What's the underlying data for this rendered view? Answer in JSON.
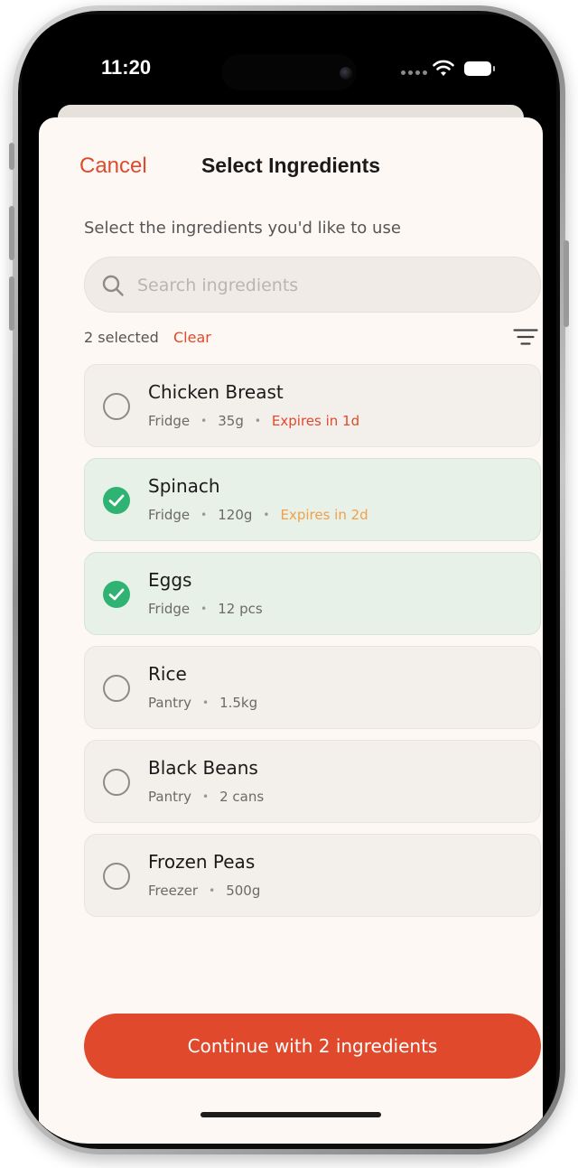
{
  "status": {
    "time": "11:20"
  },
  "header": {
    "cancel_label": "Cancel",
    "title": "Select Ingredients"
  },
  "subtitle": "Select the ingredients you'd like to use",
  "search": {
    "placeholder": "Search ingredients",
    "value": ""
  },
  "selection": {
    "count_label": "2 selected",
    "clear_label": "Clear"
  },
  "ingredients": [
    {
      "name": "Chicken Breast",
      "location": "Fridge",
      "amount": "35g",
      "expiry": "Expires in 1d",
      "expiry_color": "#df4a2c",
      "selected": false
    },
    {
      "name": "Spinach",
      "location": "Fridge",
      "amount": "120g",
      "expiry": "Expires in 2d",
      "expiry_color": "#efa04b",
      "selected": true
    },
    {
      "name": "Eggs",
      "location": "Fridge",
      "amount": "12 pcs",
      "expiry": "",
      "selected": true
    },
    {
      "name": "Rice",
      "location": "Pantry",
      "amount": "1.5kg",
      "expiry": "",
      "selected": false
    },
    {
      "name": "Black Beans",
      "location": "Pantry",
      "amount": "2 cans",
      "expiry": "",
      "selected": false
    },
    {
      "name": "Frozen Peas",
      "location": "Freezer",
      "amount": "500g",
      "expiry": "",
      "selected": false
    }
  ],
  "footer": {
    "continue_label": "Continue with 2 ingredients"
  },
  "colors": {
    "accent": "#df4a2c",
    "selected_check": "#2fb372",
    "selected_card": "#e8f1e8",
    "background": "#fdf8f4"
  }
}
